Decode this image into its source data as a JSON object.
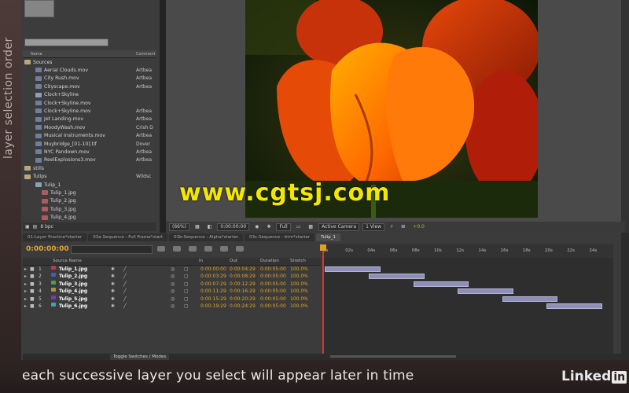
{
  "side_label": "layer selection order",
  "project": {
    "columns": [
      "Name",
      "Comment"
    ],
    "items": [
      {
        "name": "Sources",
        "comment": "",
        "kind": "folder"
      },
      {
        "name": "Aerial Clouds.mov",
        "comment": "Artbea",
        "kind": "movie"
      },
      {
        "name": "City Rush.mov",
        "comment": "Artbea",
        "kind": "movie"
      },
      {
        "name": "Cityscape.mov",
        "comment": "Artbea",
        "kind": "movie"
      },
      {
        "name": "Clock+Skyline",
        "comment": "",
        "kind": "comp"
      },
      {
        "name": "Clock+Skyline.mov",
        "comment": "",
        "kind": "movie"
      },
      {
        "name": "Clock+Skyline.mov",
        "comment": "Artbea",
        "kind": "movie"
      },
      {
        "name": "Jet Landing.mov",
        "comment": "Artbea",
        "kind": "movie"
      },
      {
        "name": "MoodyWash.mov",
        "comment": "Crish D",
        "kind": "movie"
      },
      {
        "name": "Musical Instruments.mov",
        "comment": "Artbea",
        "kind": "movie"
      },
      {
        "name": "Muybridge_[01-10].tif",
        "comment": "Dover",
        "kind": "movie"
      },
      {
        "name": "NYC Pandown.mov",
        "comment": "Artbea",
        "kind": "movie"
      },
      {
        "name": "ReelExplosions3.mov",
        "comment": "Artbea",
        "kind": "movie"
      },
      {
        "name": "stills",
        "comment": "",
        "kind": "folder"
      },
      {
        "name": "Tulips",
        "comment": "Wildsc",
        "kind": "folder"
      },
      {
        "name": "Tulip_1",
        "comment": "",
        "kind": "comp"
      },
      {
        "name": "Tulip_1.jpg",
        "comment": "",
        "kind": "img"
      },
      {
        "name": "Tulip_2.jpg",
        "comment": "",
        "kind": "img"
      },
      {
        "name": "Tulip_3.jpg",
        "comment": "",
        "kind": "img"
      },
      {
        "name": "Tulip_4.jpg",
        "comment": "",
        "kind": "img"
      }
    ],
    "bit_depth": "8 bpc"
  },
  "viewer": {
    "zoom": "(66%)",
    "timecode": "0:00:00:00",
    "resolution": "Full",
    "camera": "Active Camera",
    "view": "1 View",
    "exposure": "+0.0"
  },
  "watermark": "www.cgtsj.com",
  "timeline": {
    "tabs": [
      {
        "label": "01-Layer Practice*starter",
        "active": false
      },
      {
        "label": "03a-Sequence - Full Frame*start",
        "active": false
      },
      {
        "label": "03b-Sequence - Alpha*starter",
        "active": false
      },
      {
        "label": "03c-Sequence - trim*starter",
        "active": false
      },
      {
        "label": "Tulip_1",
        "active": true
      }
    ],
    "current_time": "0:00:00:00",
    "columns": {
      "source": "Source Name",
      "in": "In",
      "out": "Out",
      "duration": "Duration",
      "stretch": "Stretch"
    },
    "ruler_labels": [
      "0s",
      "02s",
      "04s",
      "06s",
      "08s",
      "10s",
      "12s",
      "14s",
      "16s",
      "18s",
      "20s",
      "22s",
      "24s"
    ],
    "layers": [
      {
        "num": "1",
        "name": "Tulip_1.jpg",
        "in": "0:00:00:00",
        "out": "0:00:04:29",
        "duration": "0:00:05:00",
        "stretch": "100.0%",
        "start": 0,
        "end": 5
      },
      {
        "num": "2",
        "name": "Tulip_2.jpg",
        "in": "0:00:03:29",
        "out": "0:00:08:29",
        "duration": "0:00:05:00",
        "stretch": "100.0%",
        "start": 4,
        "end": 9
      },
      {
        "num": "3",
        "name": "Tulip_3.jpg",
        "in": "0:00:07:29",
        "out": "0:00:12:29",
        "duration": "0:00:05:00",
        "stretch": "100.0%",
        "start": 8,
        "end": 13
      },
      {
        "num": "4",
        "name": "Tulip_4.jpg",
        "in": "0:00:11:29",
        "out": "0:00:16:29",
        "duration": "0:00:05:00",
        "stretch": "100.0%",
        "start": 12,
        "end": 17
      },
      {
        "num": "5",
        "name": "Tulip_5.jpg",
        "in": "0:00:15:29",
        "out": "0:00:20:29",
        "duration": "0:00:05:00",
        "stretch": "100.0%",
        "start": 16,
        "end": 21
      },
      {
        "num": "6",
        "name": "Tulip_6.jpg",
        "in": "0:00:19:29",
        "out": "0:00:24:29",
        "duration": "0:00:05:00",
        "stretch": "100.0%",
        "start": 20,
        "end": 25
      }
    ],
    "toggle_label": "Toggle Switches / Modes"
  },
  "caption": "each successive layer you select will appear later in time",
  "logo": {
    "text": "Linked",
    "badge": "in"
  }
}
